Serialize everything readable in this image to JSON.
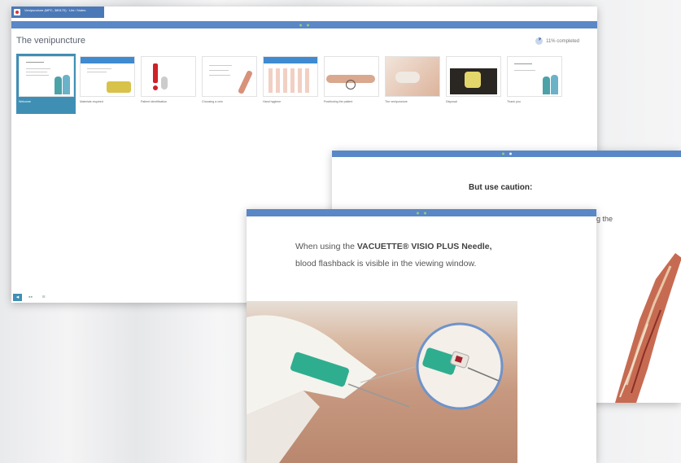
{
  "window_main": {
    "title_tab": "Venipuncture (MPC, 389170) · Lite / Notes",
    "heading": "The venipuncture",
    "progress": {
      "text": "11% completed",
      "fraction": 0.11
    },
    "slides": [
      {
        "caption": "Welcome",
        "selected": true
      },
      {
        "caption": "Materials required",
        "selected": false
      },
      {
        "caption": "Patient identification",
        "selected": false
      },
      {
        "caption": "Choosing a vein",
        "selected": false
      },
      {
        "caption": "Hand hygiene",
        "selected": false
      },
      {
        "caption": "Positioning the patient",
        "selected": false
      },
      {
        "caption": "The venipuncture",
        "selected": false
      },
      {
        "caption": "Disposal",
        "selected": false
      },
      {
        "caption": "Thank you",
        "selected": false
      }
    ],
    "view_modes": [
      "single-view-icon",
      "grid-view-icon",
      "list-view-icon"
    ]
  },
  "window_back": {
    "caution": "But use caution:",
    "partial_text": "g the"
  },
  "window_front": {
    "line1_pre": "When using the ",
    "line1_bold": "VACUETTE® VISIO PLUS Needle,",
    "line2": "blood flashback is visible in the viewing window."
  },
  "colors": {
    "accent": "#5a87c6",
    "selected": "#3f8fb5",
    "active_dot": "#9fd36a"
  }
}
